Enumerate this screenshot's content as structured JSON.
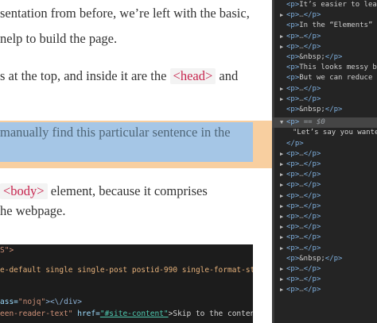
{
  "article": {
    "line1": "sentation from before, we’re left with the basic,",
    "line2": "nelp to build the page.",
    "line3_before": "s at the top, and inside it are the ",
    "line3_tag": "<head>",
    "line3_after": " and",
    "highlight": "manually find this particular sentence in the",
    "line5_tag": "<body>",
    "line5_after": " element, because it comprises",
    "line6": "he webpage."
  },
  "code": {
    "line1": "S\">",
    "line2": "e-default single single-post postid-990 single-format-stand",
    "line3_attr": "ass=",
    "line3_val": "\"nojq\"",
    "line3_rest": "><\\/div>",
    "line4_a": "een-reader-text\"",
    "line4_b": " href=",
    "line4_c": "\"#site-content\"",
    "line4_d": ">Skip to the content<\\/"
  },
  "devtools": {
    "rows": [
      {
        "arrow": "",
        "open": "<p>",
        "text": "It’s easier to lea",
        "close": "",
        "dots": ""
      },
      {
        "arrow": "▶",
        "open": "<p>",
        "text": "",
        "close": "</p>",
        "dots": "…"
      },
      {
        "arrow": "",
        "open": "<p>",
        "text": "In the “Elements”",
        "close": "",
        "dots": ""
      },
      {
        "arrow": "▶",
        "open": "<p>",
        "text": "",
        "close": "</p>",
        "dots": "…"
      },
      {
        "arrow": "▶",
        "open": "<p>",
        "text": "",
        "close": "</p>",
        "dots": "…"
      },
      {
        "arrow": "",
        "open": "<p>",
        "text": "&nbsp;",
        "close": "</p>",
        "dots": ""
      },
      {
        "arrow": "",
        "open": "<p>",
        "text": "This looks messy b",
        "close": "",
        "dots": ""
      },
      {
        "arrow": "",
        "open": "<p>",
        "text": "But we can reduce",
        "close": "",
        "dots": ""
      },
      {
        "arrow": "▶",
        "open": "<p>",
        "text": "",
        "close": "</p>",
        "dots": "…"
      },
      {
        "arrow": "▶",
        "open": "<p>",
        "text": "",
        "close": "</p>",
        "dots": "…"
      },
      {
        "arrow": "",
        "open": "<p>",
        "text": "&nbsp;",
        "close": "</p>",
        "dots": ""
      }
    ],
    "selected": {
      "arrow": "▼",
      "open": "<p>",
      "eq": "== $0"
    },
    "selected_text": "\"Let’s say you wante",
    "selected_close": "</p>",
    "rows_after": [
      {
        "arrow": "▶",
        "open": "<p>",
        "text": "",
        "close": "</p>",
        "dots": "…"
      },
      {
        "arrow": "▶",
        "open": "<p>",
        "text": "",
        "close": "</p>",
        "dots": "…"
      },
      {
        "arrow": "▶",
        "open": "<p>",
        "text": "",
        "close": "</p>",
        "dots": "…"
      },
      {
        "arrow": "▶",
        "open": "<p>",
        "text": "",
        "close": "</p>",
        "dots": "…"
      },
      {
        "arrow": "▶",
        "open": "<p>",
        "text": "",
        "close": "</p>",
        "dots": "…"
      },
      {
        "arrow": "▶",
        "open": "<p>",
        "text": "",
        "close": "</p>",
        "dots": "…"
      },
      {
        "arrow": "▶",
        "open": "<p>",
        "text": "",
        "close": "</p>",
        "dots": "…"
      },
      {
        "arrow": "▶",
        "open": "<p>",
        "text": "",
        "close": "</p>",
        "dots": "…"
      },
      {
        "arrow": "▶",
        "open": "<p>",
        "text": "",
        "close": "</p>",
        "dots": "…"
      },
      {
        "arrow": "▶",
        "open": "<p>",
        "text": "",
        "close": "</p>",
        "dots": "…"
      },
      {
        "arrow": "",
        "open": "<p>",
        "text": "&nbsp;",
        "close": "</p>",
        "dots": ""
      },
      {
        "arrow": "▶",
        "open": "<p>",
        "text": "",
        "close": "</p>",
        "dots": "…"
      },
      {
        "arrow": "▶",
        "open": "<p>",
        "text": "",
        "close": "</p>",
        "dots": "…"
      },
      {
        "arrow": "▶",
        "open": "<p>",
        "text": "",
        "close": "</p>",
        "dots": "…"
      }
    ]
  }
}
